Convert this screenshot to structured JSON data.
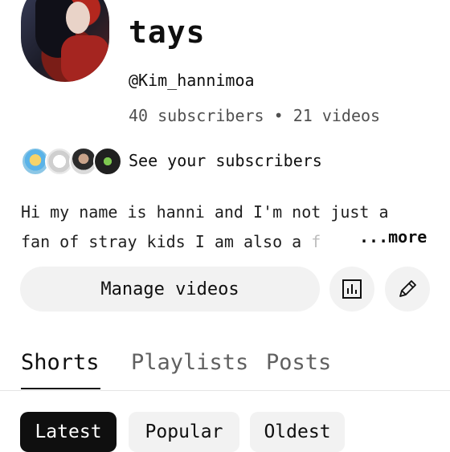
{
  "channel": {
    "name": "tays",
    "handle": "@Kim_hannimoa",
    "stats": "40 subscribers • 21 videos"
  },
  "subscribers_row": {
    "label": "See your subscribers",
    "avatars": [
      "subscriber-avatar-1",
      "subscriber-avatar-2",
      "subscriber-avatar-3",
      "subscriber-avatar-4"
    ]
  },
  "description": {
    "line1": "Hi my name is hanni and I'm not just a",
    "line2": "fan of stray kids I am also a ",
    "line2_fade": "f",
    "more_label": "...more"
  },
  "actions": {
    "manage_label": "Manage videos",
    "analytics_icon": "analytics-icon",
    "edit_icon": "pencil-icon"
  },
  "tabs": [
    {
      "label": "Shorts",
      "active": true
    },
    {
      "label": "Playlists",
      "active": false
    },
    {
      "label": "Posts",
      "active": false
    }
  ],
  "filters": [
    {
      "label": "Latest",
      "selected": true
    },
    {
      "label": "Popular",
      "selected": false
    },
    {
      "label": "Oldest",
      "selected": false
    }
  ],
  "colors": {
    "text": "#0f0f0f",
    "secondary_text": "#606060",
    "button_bg": "#f2f2f2",
    "selected_chip_bg": "#0f0f0f"
  }
}
